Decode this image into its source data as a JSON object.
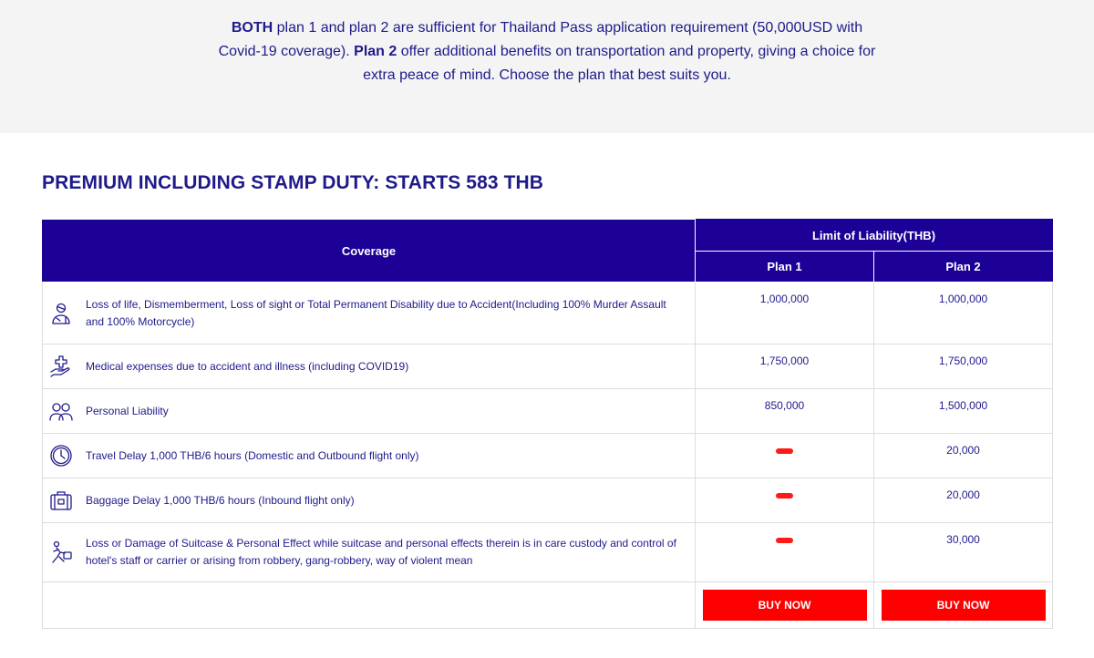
{
  "intro": {
    "both": "BOTH",
    "text1": " plan 1 and plan 2 are sufficient for Thailand Pass application requirement (50,000USD with Covid-19 coverage). ",
    "plan2": "Plan 2",
    "text2": " offer additional benefits on transportation and property, giving a choice for extra peace of mind. Choose the plan that best suits you."
  },
  "premium_title": "PREMIUM INCLUDING STAMP DUTY: STARTS 583 THB",
  "table": {
    "coverage_header": "Coverage",
    "limit_header": "Limit of Liability(THB)",
    "plan1_header": "Plan 1",
    "plan2_header": "Plan 2",
    "rows": [
      {
        "icon": "injured-person-icon",
        "coverage": "Loss of life, Dismemberment, Loss of sight or Total Permanent Disability due to Accident(Including 100% Murder Assault and 100% Motorcycle)",
        "plan1": "1,000,000",
        "plan2": "1,000,000"
      },
      {
        "icon": "medical-hand-icon",
        "coverage": "Medical expenses due to accident and illness (including COVID19)",
        "plan1": "1,750,000",
        "plan2": "1,750,000"
      },
      {
        "icon": "people-icon",
        "coverage": "Personal Liability",
        "plan1": "850,000",
        "plan2": "1,500,000"
      },
      {
        "icon": "clock-icon",
        "coverage": "Travel Delay 1,000 THB/6 hours (Domestic and Outbound flight only)",
        "plan1": null,
        "plan2": "20,000"
      },
      {
        "icon": "suitcase-icon",
        "coverage": "Baggage Delay 1,000 THB/6 hours (Inbound flight only)",
        "plan1": null,
        "plan2": "20,000"
      },
      {
        "icon": "running-thief-icon",
        "coverage": "Loss or Damage of Suitcase & Personal Effect while suitcase and personal effects therein is in care custody and control of hotel's staff or carrier or arising from robbery, gang-robbery, way of violent mean",
        "plan1": null,
        "plan2": "30,000"
      }
    ],
    "buy_label": "BUY NOW"
  },
  "colors": {
    "brand_navy": "#1d0096",
    "text_navy": "#1f1a8a",
    "accent_red": "#ff0000",
    "intro_bg": "#f4f4f4"
  }
}
